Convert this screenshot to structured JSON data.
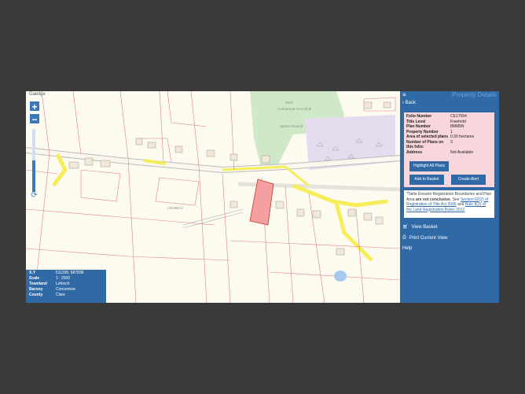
{
  "map": {
    "language_link": "Gaeilge",
    "zoom_in": "+",
    "zoom_out": "−",
    "place_labels": {
      "townland_center": "LEHINCH",
      "club_top": "Corcomroe GAA Club",
      "club_sub": "Sports Ground",
      "top_label": "Pitch"
    },
    "info_box": {
      "rows": [
        {
          "key": "X,Y",
          "value": "511199, 687838"
        },
        {
          "key": "Scale",
          "value": "1 : 2500"
        },
        {
          "key": "Townland",
          "value": "Lehinch"
        },
        {
          "key": "Barony",
          "value": "Corcomroe"
        },
        {
          "key": "County",
          "value": "Clare"
        }
      ]
    }
  },
  "panel": {
    "title": "Property Details",
    "back_label": "Back",
    "details": [
      {
        "key": "Folio Number",
        "value": "CE17094"
      },
      {
        "key": "Title Level",
        "value": "Freehold"
      },
      {
        "key": "Plan Number",
        "value": "8MM5N"
      },
      {
        "key": "Property Number",
        "value": "1"
      },
      {
        "key": "Area of selected plans",
        "value": "0.30 hectares"
      },
      {
        "key": "Number of Plans on this folio:",
        "value": "3"
      },
      {
        "key": "Address",
        "value": "Not Available"
      }
    ],
    "highlight_button": "Highlight All Plans",
    "add_basket_button": "Add to Basket",
    "create_alert_button": "Create Alert",
    "notice": {
      "prefix": "*Tailte Éireann Registration Boundaries and Plan Area ",
      "bold": "are not conclusive",
      "mid": ". See ",
      "link1": "Section 62(2) of Registration of Title Act 2006",
      "and": " and ",
      "link2": "Rule 8(3) of the Land Registration Rules 2012"
    },
    "view_basket": "View Basket",
    "print_view": "Print Current View",
    "help": "Help"
  },
  "colors": {
    "accent": "#2f6aa6",
    "road": "#f5ee5a",
    "selected_plot": "#f4a0a0",
    "details_bg": "#f8d7dc"
  }
}
